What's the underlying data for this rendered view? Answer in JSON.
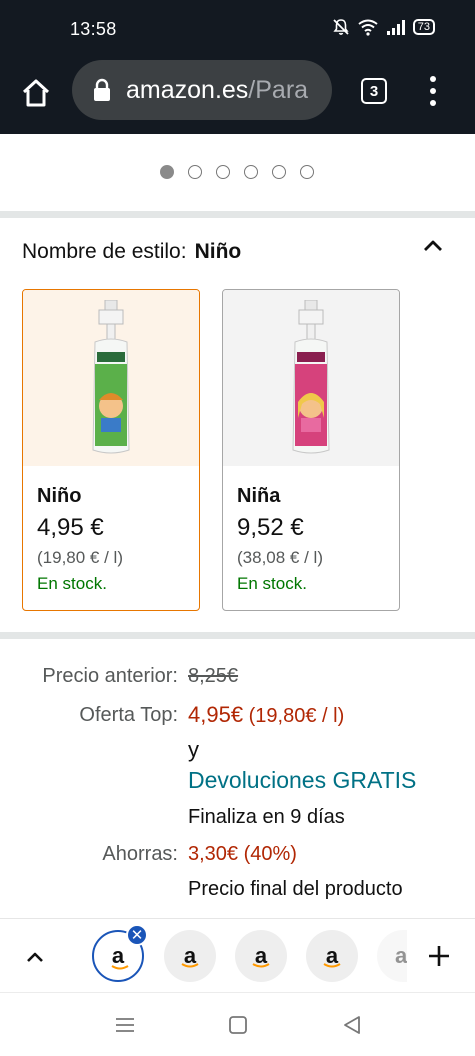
{
  "status_bar": {
    "time": "13:58",
    "battery": "73",
    "icons": [
      "mute-icon",
      "wifi-icon",
      "signal-icon",
      "battery-icon"
    ]
  },
  "browser": {
    "url_domain": "amazon.es",
    "url_path": "/Para",
    "tab_count": "3",
    "icons": [
      "home-icon",
      "lock-icon",
      "menu-icon"
    ]
  },
  "carousel": {
    "total_dots": 6,
    "active_index": 0
  },
  "style_selector": {
    "label": "Nombre de estilo:",
    "selected_value": "Niño",
    "options": [
      {
        "name": "Niño",
        "price": "4,95 €",
        "unit_price": "(19,80 € / l)",
        "stock": "En stock.",
        "selected": true
      },
      {
        "name": "Niña",
        "price": "9,52 €",
        "unit_price": "(38,08 € / l)",
        "stock": "En stock.",
        "selected": false
      }
    ]
  },
  "pricing": {
    "previous_label": "Precio anterior:",
    "previous_value": "8,25€",
    "deal_label": "Oferta Top:",
    "deal_price": "4,95€",
    "deal_unit": "(19,80€ / l)",
    "and_text": "y",
    "returns_link": "Devoluciones GRATIS",
    "ends_text": "Finaliza en 9 días",
    "savings_label": "Ahorras:",
    "savings_value": "3,30€ (40%)",
    "final_text": "Precio final del producto"
  },
  "tab_strip": {
    "tab_letter": "a",
    "tabs": 5
  },
  "colors": {
    "header_bg": "#131921",
    "selected_border": "#e77600",
    "deal_red": "#b12704",
    "link_teal": "#007185",
    "stock_green": "#007600",
    "tab_blue": "#1a55b8"
  }
}
